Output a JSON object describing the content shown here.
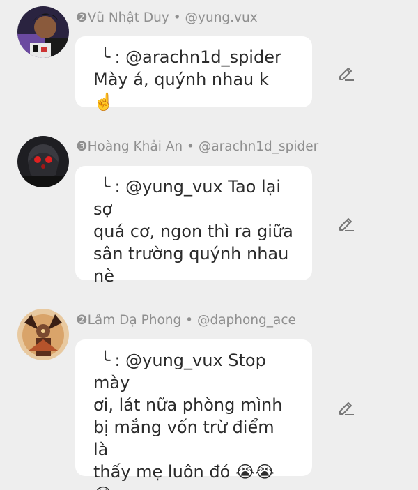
{
  "messages": [
    {
      "author": "❷Vũ Nhật Duy",
      "separator": "•",
      "handle": "@yung.vux",
      "reply_symbol": "╰",
      "reply_to": ": @arachn1d_spider",
      "lines": [
        "Mày á, quýnh nhau k ☝️"
      ]
    },
    {
      "author": "❸Hoàng Khải An",
      "separator": "•",
      "handle": "@arachn1d_spider",
      "reply_symbol": "╰",
      "reply_to": ": @yung_vux Tao lại sợ",
      "lines": [
        "quá cơ, ngon thì ra giữa",
        "sân trường quýnh nhau",
        "nè"
      ]
    },
    {
      "author": "❷Lâm Dạ Phong",
      "separator": "•",
      "handle": "@daphong_ace",
      "reply_symbol": "╰",
      "reply_to": ": @yung_vux Stop mày",
      "lines": [
        "ơi, lát nữa phòng mình",
        "bị mắng vốn trừ điểm là",
        "thấy mẹ luôn đó 😭😭",
        "😭"
      ]
    }
  ],
  "icons": {
    "edit": "pencil-edit-icon",
    "edit_color": "#777777"
  }
}
